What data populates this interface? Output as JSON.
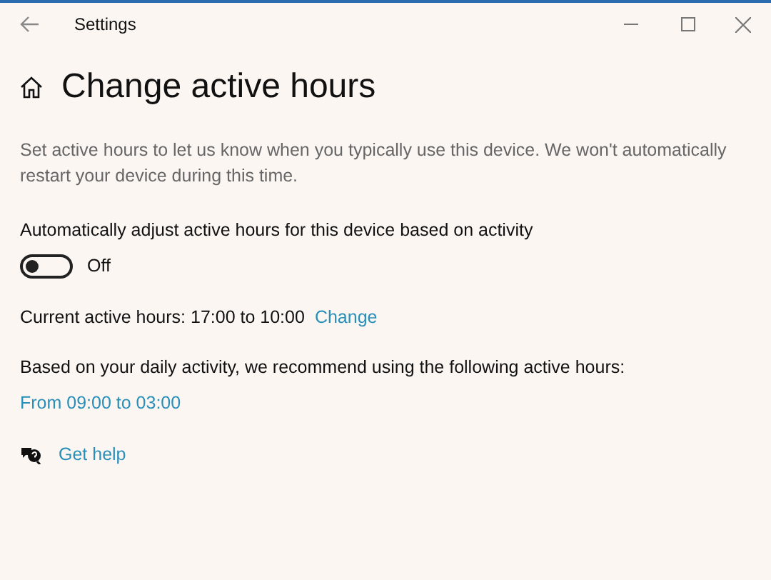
{
  "window": {
    "title": "Settings"
  },
  "page": {
    "title": "Change active hours",
    "description": "Set active hours to let us know when you typically use this device. We won't automatically restart your device during this time."
  },
  "toggle": {
    "label": "Automatically adjust active hours for this device based on activity",
    "on": false,
    "state_text": "Off"
  },
  "current": {
    "text": "Current active hours: 17:00 to 10:00",
    "link": "Change"
  },
  "recommendation": {
    "text": "Based on your daily activity, we recommend using the following active hours:",
    "link": "From 09:00 to 03:00"
  },
  "help": {
    "link": "Get help"
  }
}
